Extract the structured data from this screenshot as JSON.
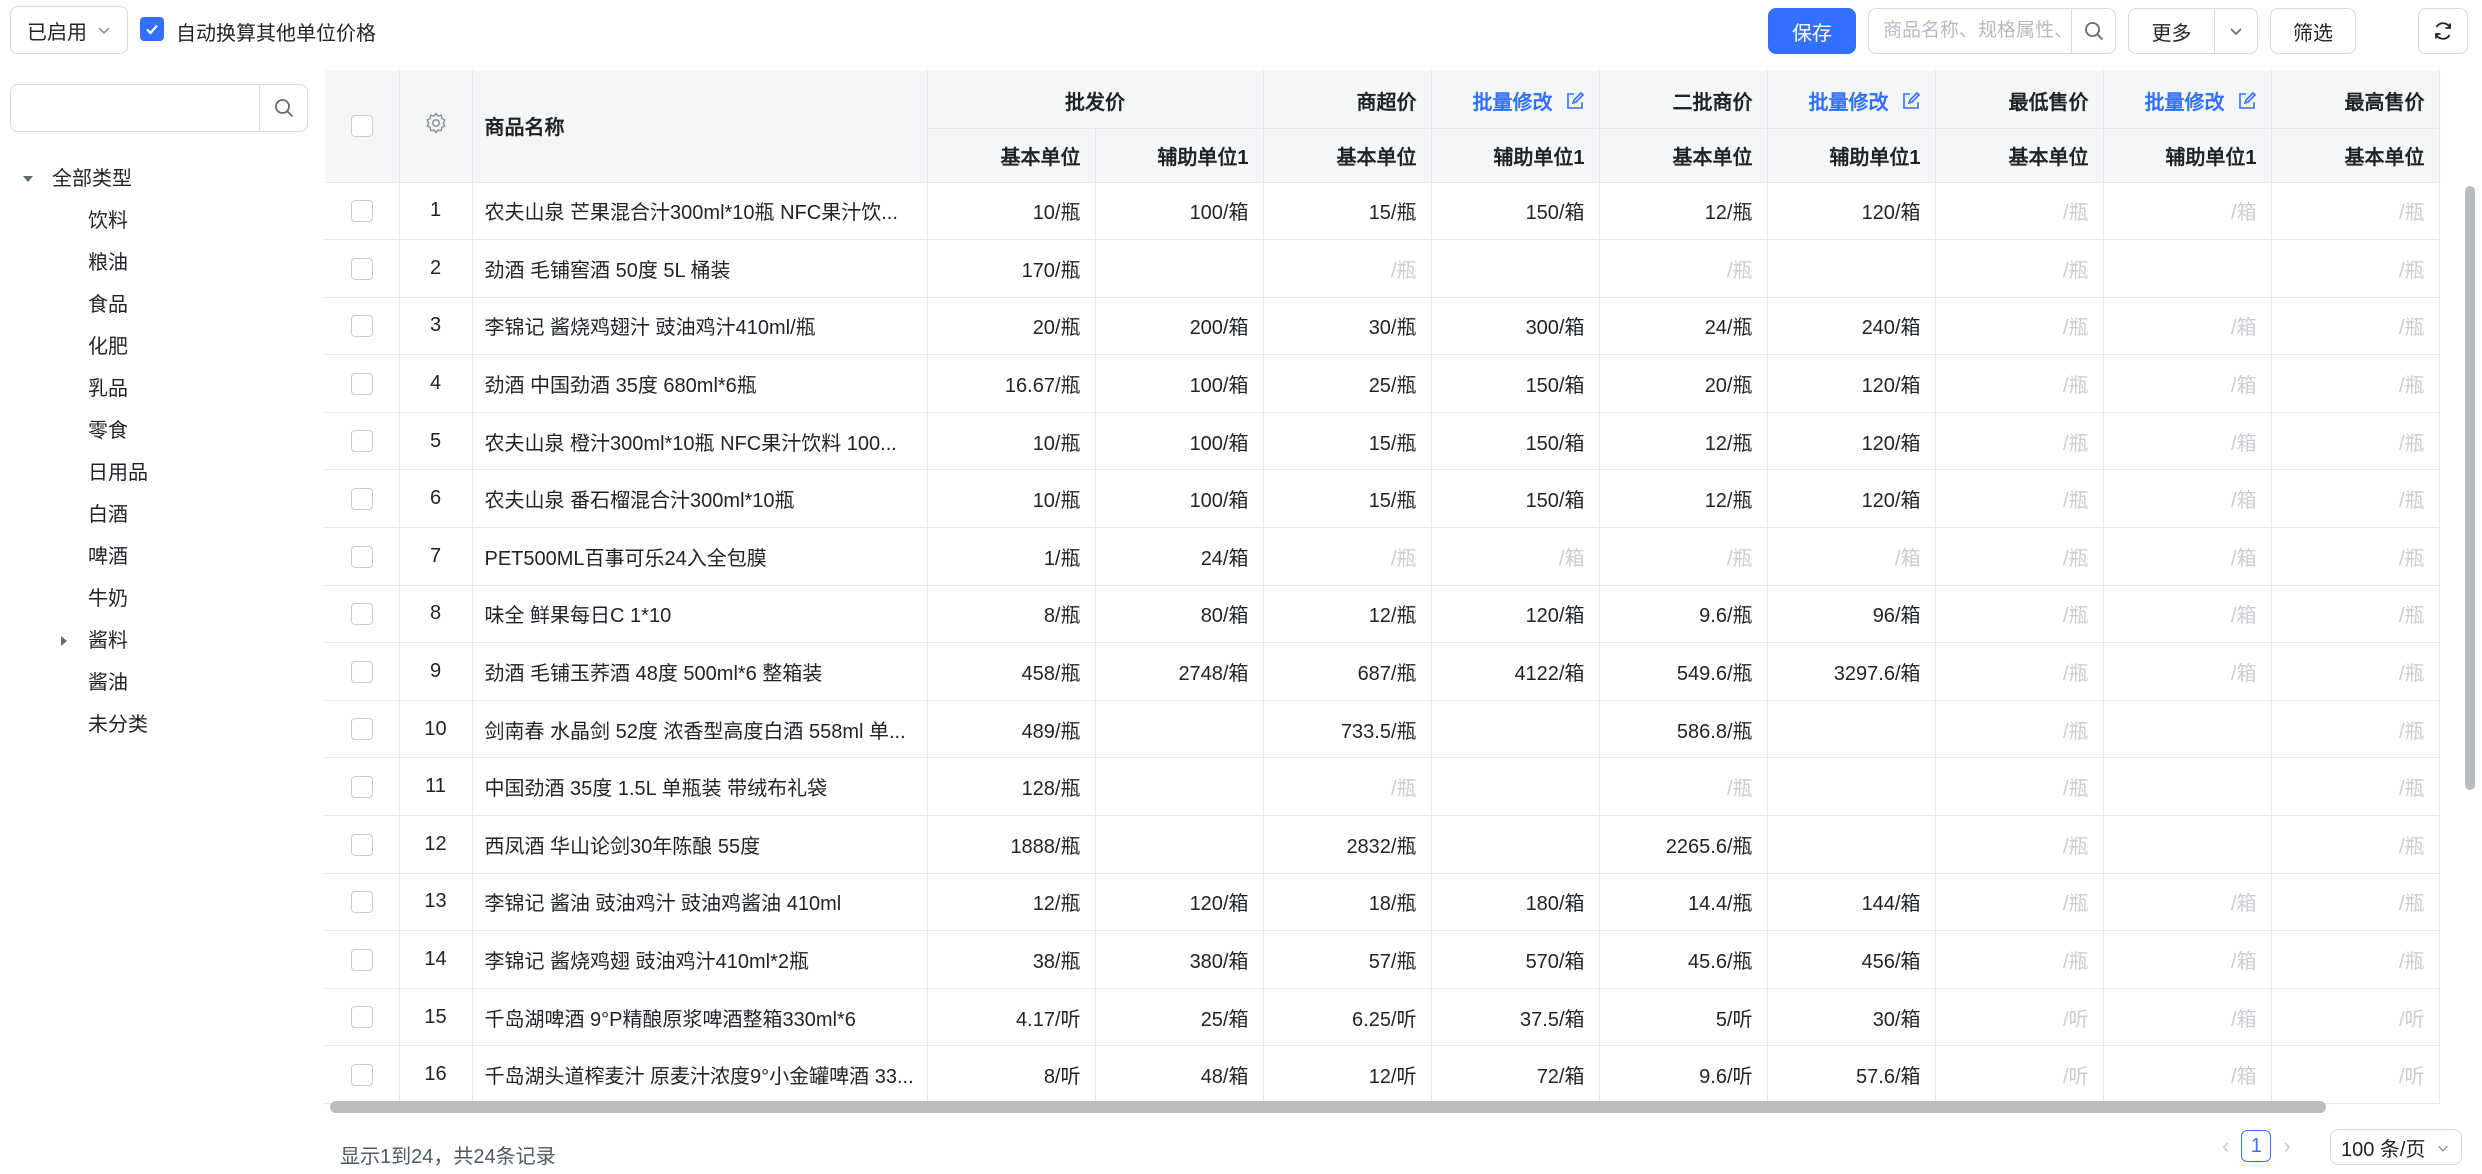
{
  "toolbar": {
    "status_value": "已启用",
    "auto_convert_label": "自动换算其他单位价格",
    "auto_convert_checked": true,
    "save_label": "保存",
    "search_placeholder": "商品名称、规格属性、...",
    "more_label": "更多",
    "filter_label": "筛选"
  },
  "sidebar": {
    "search_value": "",
    "root": "全部类型",
    "categories": [
      "饮料",
      "粮油",
      "食品",
      "化肥",
      "乳品",
      "零食",
      "日用品",
      "白酒",
      "啤酒",
      "牛奶",
      "酱料",
      "酱油",
      "未分类"
    ]
  },
  "table": {
    "name_header": "商品名称",
    "groups": {
      "wholesale": "批发价",
      "supermarket": "商超价",
      "secondary": "二批商价",
      "min_price": "最低售价",
      "max_price": "最高售价",
      "batch_edit": "批量修改"
    },
    "sub_headers": {
      "base": "基本单位",
      "aux": "辅助单位1"
    },
    "rows": [
      {
        "no": "1",
        "name": "农夫山泉 芒果混合汁300ml*10瓶 NFC果汁饮...",
        "w_base": "10/瓶",
        "w_aux": "100/箱",
        "s_base": "15/瓶",
        "s_aux": "150/箱",
        "e_base": "12/瓶",
        "e_aux": "120/箱",
        "min_base": "/瓶",
        "min_aux": "/箱",
        "max_base": "/瓶"
      },
      {
        "no": "2",
        "name": "劲酒 毛铺窖酒 50度 5L 桶装",
        "w_base": "170/瓶",
        "w_aux": "",
        "s_base": "/瓶",
        "s_aux": "",
        "e_base": "/瓶",
        "e_aux": "",
        "min_base": "/瓶",
        "min_aux": "",
        "max_base": "/瓶"
      },
      {
        "no": "3",
        "name": "李锦记 酱烧鸡翅汁 豉油鸡汁410ml/瓶",
        "w_base": "20/瓶",
        "w_aux": "200/箱",
        "s_base": "30/瓶",
        "s_aux": "300/箱",
        "e_base": "24/瓶",
        "e_aux": "240/箱",
        "min_base": "/瓶",
        "min_aux": "/箱",
        "max_base": "/瓶"
      },
      {
        "no": "4",
        "name": "劲酒 中国劲酒 35度 680ml*6瓶",
        "w_base": "16.67/瓶",
        "w_aux": "100/箱",
        "s_base": "25/瓶",
        "s_aux": "150/箱",
        "e_base": "20/瓶",
        "e_aux": "120/箱",
        "min_base": "/瓶",
        "min_aux": "/箱",
        "max_base": "/瓶"
      },
      {
        "no": "5",
        "name": "农夫山泉 橙汁300ml*10瓶 NFC果汁饮料 100...",
        "w_base": "10/瓶",
        "w_aux": "100/箱",
        "s_base": "15/瓶",
        "s_aux": "150/箱",
        "e_base": "12/瓶",
        "e_aux": "120/箱",
        "min_base": "/瓶",
        "min_aux": "/箱",
        "max_base": "/瓶"
      },
      {
        "no": "6",
        "name": "农夫山泉 番石榴混合汁300ml*10瓶",
        "w_base": "10/瓶",
        "w_aux": "100/箱",
        "s_base": "15/瓶",
        "s_aux": "150/箱",
        "e_base": "12/瓶",
        "e_aux": "120/箱",
        "min_base": "/瓶",
        "min_aux": "/箱",
        "max_base": "/瓶"
      },
      {
        "no": "7",
        "name": "PET500ML百事可乐24入全包膜",
        "w_base": "1/瓶",
        "w_aux": "24/箱",
        "s_base": "/瓶",
        "s_aux": "/箱",
        "e_base": "/瓶",
        "e_aux": "/箱",
        "min_base": "/瓶",
        "min_aux": "/箱",
        "max_base": "/瓶"
      },
      {
        "no": "8",
        "name": "味全 鲜果每日C 1*10",
        "w_base": "8/瓶",
        "w_aux": "80/箱",
        "s_base": "12/瓶",
        "s_aux": "120/箱",
        "e_base": "9.6/瓶",
        "e_aux": "96/箱",
        "min_base": "/瓶",
        "min_aux": "/箱",
        "max_base": "/瓶"
      },
      {
        "no": "9",
        "name": "劲酒 毛铺玉荞酒 48度 500ml*6 整箱装",
        "w_base": "458/瓶",
        "w_aux": "2748/箱",
        "s_base": "687/瓶",
        "s_aux": "4122/箱",
        "e_base": "549.6/瓶",
        "e_aux": "3297.6/箱",
        "min_base": "/瓶",
        "min_aux": "/箱",
        "max_base": "/瓶"
      },
      {
        "no": "10",
        "name": "剑南春 水晶剑 52度 浓香型高度白酒 558ml 单...",
        "w_base": "489/瓶",
        "w_aux": "",
        "s_base": "733.5/瓶",
        "s_aux": "",
        "e_base": "586.8/瓶",
        "e_aux": "",
        "min_base": "/瓶",
        "min_aux": "",
        "max_base": "/瓶"
      },
      {
        "no": "11",
        "name": "中国劲酒 35度 1.5L 单瓶装 带绒布礼袋",
        "w_base": "128/瓶",
        "w_aux": "",
        "s_base": "/瓶",
        "s_aux": "",
        "e_base": "/瓶",
        "e_aux": "",
        "min_base": "/瓶",
        "min_aux": "",
        "max_base": "/瓶"
      },
      {
        "no": "12",
        "name": "西凤酒 华山论剑30年陈酿 55度",
        "w_base": "1888/瓶",
        "w_aux": "",
        "s_base": "2832/瓶",
        "s_aux": "",
        "e_base": "2265.6/瓶",
        "e_aux": "",
        "min_base": "/瓶",
        "min_aux": "",
        "max_base": "/瓶"
      },
      {
        "no": "13",
        "name": "李锦记 酱油 豉油鸡汁 豉油鸡酱油 410ml",
        "w_base": "12/瓶",
        "w_aux": "120/箱",
        "s_base": "18/瓶",
        "s_aux": "180/箱",
        "e_base": "14.4/瓶",
        "e_aux": "144/箱",
        "min_base": "/瓶",
        "min_aux": "/箱",
        "max_base": "/瓶"
      },
      {
        "no": "14",
        "name": "李锦记 酱烧鸡翅 豉油鸡汁410ml*2瓶",
        "w_base": "38/瓶",
        "w_aux": "380/箱",
        "s_base": "57/瓶",
        "s_aux": "570/箱",
        "e_base": "45.6/瓶",
        "e_aux": "456/箱",
        "min_base": "/瓶",
        "min_aux": "/箱",
        "max_base": "/瓶"
      },
      {
        "no": "15",
        "name": "千岛湖啤酒 9°P精酿原浆啤酒整箱330ml*6",
        "w_base": "4.17/听",
        "w_aux": "25/箱",
        "s_base": "6.25/听",
        "s_aux": "37.5/箱",
        "e_base": "5/听",
        "e_aux": "30/箱",
        "min_base": "/听",
        "min_aux": "/箱",
        "max_base": "/听"
      },
      {
        "no": "16",
        "name": "千岛湖头道榨麦汁 原麦汁浓度9°小金罐啤酒 33...",
        "w_base": "8/听",
        "w_aux": "48/箱",
        "s_base": "12/听",
        "s_aux": "72/箱",
        "e_base": "9.6/听",
        "e_aux": "57.6/箱",
        "min_base": "/听",
        "min_aux": "/箱",
        "max_base": "/听"
      }
    ]
  },
  "footer": {
    "info": "显示1到24，共24条记录",
    "current_page": "1",
    "page_size": "100 条/页"
  },
  "colors": {
    "accent": "#3370ff",
    "header_bg": "#f5f6f7",
    "border": "#e4e6ea",
    "placeholder_text": "#c9ccd2"
  }
}
